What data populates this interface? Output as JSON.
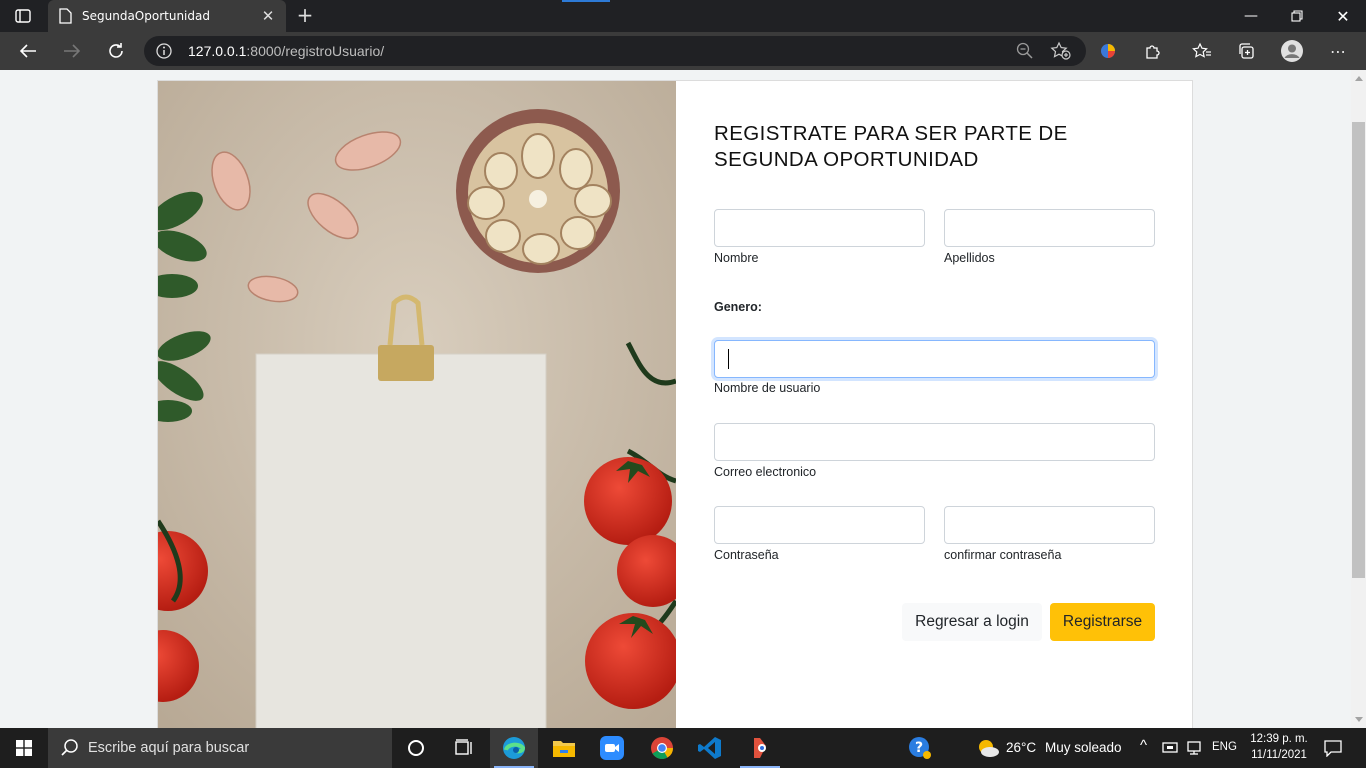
{
  "browser": {
    "tab_title": "SegundaOportunidad",
    "url_host": "127.0.0.1",
    "url_rest": ":8000/registroUsuario/"
  },
  "form": {
    "heading": "REGISTRATE PARA SER PARTE DE SEGUNDA OPORTUNIDAD",
    "nombre_label": "Nombre",
    "apellidos_label": "Apellidos",
    "genero_label": "Genero:",
    "usuario_label": "Nombre de usuario",
    "correo_label": "Correo electronico",
    "password_label": "Contraseña",
    "confirm_label": "confirmar contraseña",
    "back_button": "Regresar a login",
    "submit_button": "Registrarse"
  },
  "taskbar": {
    "search_placeholder": "Escribe aquí para buscar",
    "temperature": "26°C",
    "weather": "Muy soleado",
    "language": "ENG",
    "time": "12:39 p. m.",
    "date": "11/11/2021"
  },
  "colors": {
    "submit_bg": "#ffc107",
    "back_bg": "#f8f9fa",
    "focus_border": "#86b7fe"
  }
}
